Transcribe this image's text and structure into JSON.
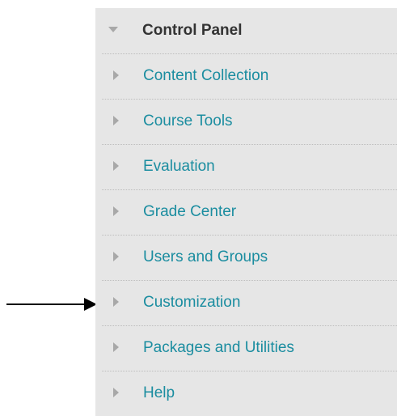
{
  "control_panel": {
    "title": "Control Panel",
    "expanded": true,
    "items": [
      {
        "label": "Content Collection"
      },
      {
        "label": "Course Tools"
      },
      {
        "label": "Evaluation"
      },
      {
        "label": "Grade Center"
      },
      {
        "label": "Users and Groups"
      },
      {
        "label": "Customization"
      },
      {
        "label": "Packages and Utilities"
      },
      {
        "label": "Help"
      }
    ]
  },
  "colors": {
    "panel_background": "#e6e6e6",
    "link": "#1b8da0",
    "header_text": "#333333",
    "triangle": "#a8a8a8",
    "pointer_arrow": "#000000"
  },
  "icons": {
    "header": "triangle-down-icon",
    "item": "triangle-right-icon",
    "annotation": "arrow-right-icon"
  }
}
